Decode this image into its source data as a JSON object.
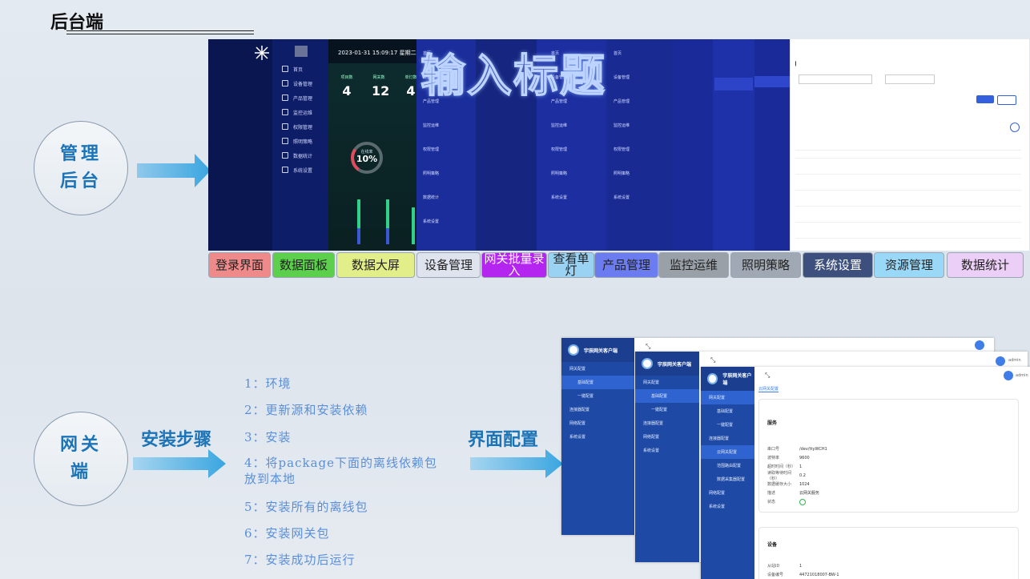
{
  "page_title": "后台端",
  "admin": {
    "circle_line1": "管理",
    "circle_line2": "后台",
    "login_time": "2023-01-31 15:09:17 星期二",
    "big_overlay": "输入标题",
    "gauge_label": "在线率",
    "gauge_value": "10%",
    "stat_labels": [
      "项目数",
      "网关数",
      "单灯数"
    ],
    "stat_values": [
      "4",
      "12",
      "4"
    ],
    "nav_items": [
      "首页",
      "设备管理",
      "产品管理",
      "监控运维",
      "权限管理",
      "照明策略",
      "数据统计",
      "系统设置"
    ],
    "labels": [
      "登录界面",
      "数据面板",
      "数据大屏",
      "设备管理",
      "网关批量录入",
      "查看单灯",
      "产品管理",
      "监控运维",
      "照明策略",
      "系统设置",
      "资源管理",
      "数据统计"
    ]
  },
  "gateway": {
    "circle_line1": "网关",
    "circle_line2": "端",
    "install_title": "安装步骤",
    "ui_title": "界面配置",
    "steps": [
      "1：环境",
      "2：更新源和安装依赖",
      "3：安装",
      "4：将package下面的离线依赖包放到本地",
      "5：安装所有的离线包",
      "6：安装网关包",
      "7：安装成功后运行"
    ],
    "app_name": "宇辰网关客户端",
    "user": "admin",
    "menu": [
      "网关配置",
      "基础配置",
      "一键配置",
      "连接器配置",
      "网络配置",
      "系统设置"
    ],
    "submenu": [
      "云网关配置",
      "范围路由配置",
      "数据采集器配置"
    ],
    "tab": "云网关配置",
    "service_title": "服务",
    "service_fields": [
      {
        "k": "串口号",
        "v": "/dev/ttyWCH1"
      },
      {
        "k": "波特率",
        "v": "9600"
      },
      {
        "k": "超时时间（秒）",
        "v": "1"
      },
      {
        "k": "读取等待时间（秒）",
        "v": "0.2"
      },
      {
        "k": "数据缓存大小",
        "v": "1024"
      },
      {
        "k": "描述",
        "v": "云网关服务"
      },
      {
        "k": "状态",
        "v": ""
      }
    ],
    "device_title": "设备",
    "device_fields": [
      {
        "k": "从站ID",
        "v": "1"
      },
      {
        "k": "设备编号",
        "v": "44721018007-BW-1"
      }
    ]
  }
}
